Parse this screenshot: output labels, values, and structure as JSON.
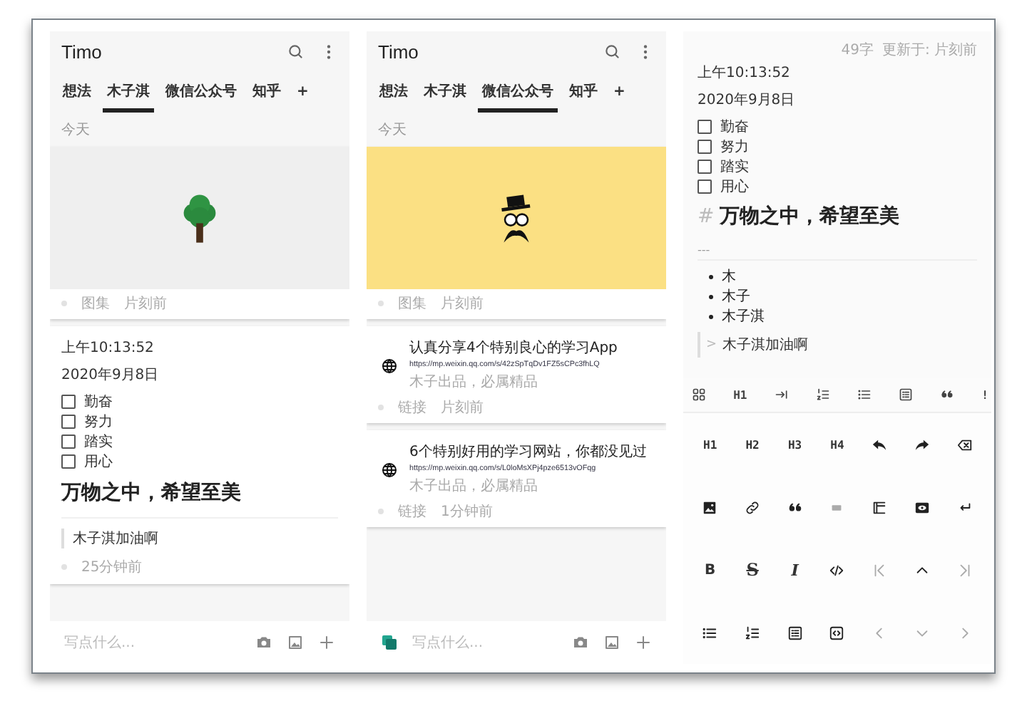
{
  "panels": [
    {
      "kind": "feed",
      "title": "Timo",
      "tabs": [
        {
          "label": "想法",
          "selected": false
        },
        {
          "label": "木子淇",
          "selected": true
        },
        {
          "label": "微信公众号",
          "selected": false
        },
        {
          "label": "知乎",
          "selected": false
        },
        {
          "label": "+",
          "selected": false
        }
      ],
      "section": "今天",
      "cards": [
        {
          "kind": "gallery",
          "tag": "图集",
          "time": "片刻前"
        },
        {
          "kind": "note",
          "lines": [
            "上午10:13:52",
            "2020年9月8日"
          ],
          "todos": [
            {
              "label": "勤奋",
              "checked": false
            },
            {
              "label": "努力",
              "checked": false
            },
            {
              "label": "踏实",
              "checked": false
            },
            {
              "label": "用心",
              "checked": false
            }
          ],
          "heading": "万物之中，希望至美",
          "quote": "木子淇加油啊",
          "time": "25分钟前"
        }
      ],
      "composer": {
        "placeholder": "写点什么...",
        "app_badge": false
      }
    },
    {
      "kind": "feed",
      "title": "Timo",
      "tabs": [
        {
          "label": "想法",
          "selected": false
        },
        {
          "label": "木子淇",
          "selected": false
        },
        {
          "label": "微信公众号",
          "selected": true
        },
        {
          "label": "知乎",
          "selected": false
        },
        {
          "label": "+",
          "selected": false
        }
      ],
      "section": "今天",
      "cards": [
        {
          "kind": "gallery",
          "tag": "图集",
          "time": "片刻前"
        },
        {
          "kind": "link",
          "title": "认真分享4个特别良心的学习App",
          "url": "https://mp.weixin.qq.com/s/42zSpTqDv1FZ5sCPc3fhLQ",
          "note": "木子出品，必属精品",
          "tag": "链接",
          "time": "片刻前"
        },
        {
          "kind": "link",
          "title": "6个特别好用的学习网站，你都没见过",
          "url": "https://mp.weixin.qq.com/s/L0loMsXPj4pze6513vOFqg",
          "note": "木子出品，必属精品",
          "tag": "链接",
          "time": "1分钟前"
        }
      ],
      "composer": {
        "placeholder": "写点什么...",
        "app_badge": true
      }
    },
    {
      "kind": "editor",
      "meta": [
        "49字",
        "更新于: 片刻前"
      ],
      "lines": [
        "上午10:13:52",
        "2020年9月8日"
      ],
      "todos": [
        {
          "label": "勤奋",
          "checked": false
        },
        {
          "label": "努力",
          "checked": false
        },
        {
          "label": "踏实",
          "checked": false
        },
        {
          "label": "用心",
          "checked": false
        }
      ],
      "heading_mark": "#",
      "heading": "万物之中，希望至美",
      "rule": "---",
      "bullets": [
        "木",
        "木子",
        "木子淇"
      ],
      "quote_mark": ">",
      "quote": "木子淇加油啊",
      "toolbar": [
        {
          "kind": "icon"
        },
        {
          "kind": "label",
          "label": "H1"
        },
        {
          "kind": "icon"
        },
        {
          "kind": "icon"
        },
        {
          "kind": "icon"
        },
        {
          "kind": "icon"
        },
        {
          "kind": "icon"
        },
        {
          "kind": "label",
          "label": "!"
        }
      ],
      "keys": [
        {
          "kind": "label",
          "label": "H1",
          "disabled": false
        },
        {
          "kind": "label",
          "label": "H2",
          "disabled": false
        },
        {
          "kind": "label",
          "label": "H3",
          "disabled": false
        },
        {
          "kind": "label",
          "label": "H4",
          "disabled": false
        },
        {
          "kind": "icon",
          "disabled": false
        },
        {
          "kind": "icon",
          "disabled": false
        },
        {
          "kind": "icon",
          "disabled": false
        },
        {
          "kind": "icon",
          "disabled": false
        },
        {
          "kind": "icon",
          "disabled": false
        },
        {
          "kind": "icon",
          "disabled": false
        },
        {
          "kind": "icon",
          "disabled": true
        },
        {
          "kind": "icon",
          "disabled": false
        },
        {
          "kind": "icon",
          "disabled": false
        },
        {
          "kind": "icon",
          "disabled": false
        },
        {
          "kind": "bold",
          "label": "B",
          "disabled": false
        },
        {
          "kind": "strike",
          "label": "S",
          "disabled": false
        },
        {
          "kind": "italic",
          "label": "I",
          "disabled": false
        },
        {
          "kind": "icon",
          "disabled": false
        },
        {
          "kind": "icon",
          "disabled": true
        },
        {
          "kind": "icon",
          "disabled": false
        },
        {
          "kind": "icon",
          "disabled": true
        },
        {
          "kind": "icon",
          "disabled": false
        },
        {
          "kind": "icon",
          "disabled": false
        },
        {
          "kind": "icon",
          "disabled": false
        },
        {
          "kind": "icon",
          "disabled": false
        },
        {
          "kind": "icon",
          "disabled": true
        },
        {
          "kind": "icon",
          "disabled": true
        },
        {
          "kind": "icon",
          "disabled": true
        }
      ]
    }
  ]
}
